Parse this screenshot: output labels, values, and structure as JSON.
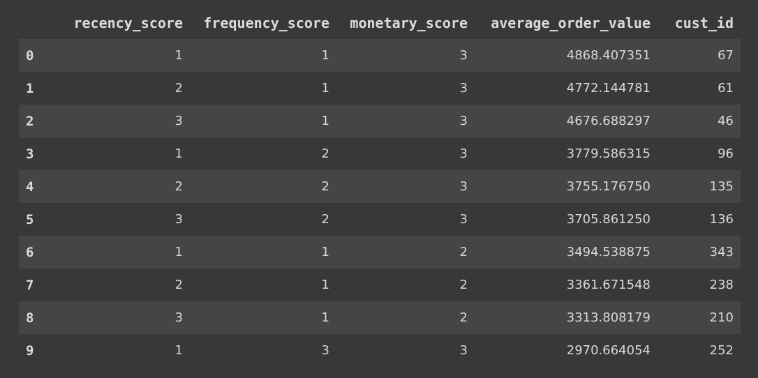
{
  "table": {
    "index_header": "",
    "columns": [
      "recency_score",
      "frequency_score",
      "monetary_score",
      "average_order_value",
      "cust_id"
    ],
    "rows": [
      {
        "index": "0",
        "cells": [
          "1",
          "1",
          "3",
          "4868.407351",
          "67"
        ]
      },
      {
        "index": "1",
        "cells": [
          "2",
          "1",
          "3",
          "4772.144781",
          "61"
        ]
      },
      {
        "index": "2",
        "cells": [
          "3",
          "1",
          "3",
          "4676.688297",
          "46"
        ]
      },
      {
        "index": "3",
        "cells": [
          "1",
          "2",
          "3",
          "3779.586315",
          "96"
        ]
      },
      {
        "index": "4",
        "cells": [
          "2",
          "2",
          "3",
          "3755.176750",
          "135"
        ]
      },
      {
        "index": "5",
        "cells": [
          "3",
          "2",
          "3",
          "3705.861250",
          "136"
        ]
      },
      {
        "index": "6",
        "cells": [
          "1",
          "1",
          "2",
          "3494.538875",
          "343"
        ]
      },
      {
        "index": "7",
        "cells": [
          "2",
          "1",
          "2",
          "3361.671548",
          "238"
        ]
      },
      {
        "index": "8",
        "cells": [
          "3",
          "1",
          "2",
          "3313.808179",
          "210"
        ]
      },
      {
        "index": "9",
        "cells": [
          "1",
          "3",
          "3",
          "2970.664054",
          "252"
        ]
      }
    ]
  },
  "colors": {
    "background": "#383838",
    "row_stripe": "#454545",
    "text": "#d8d8d8"
  }
}
